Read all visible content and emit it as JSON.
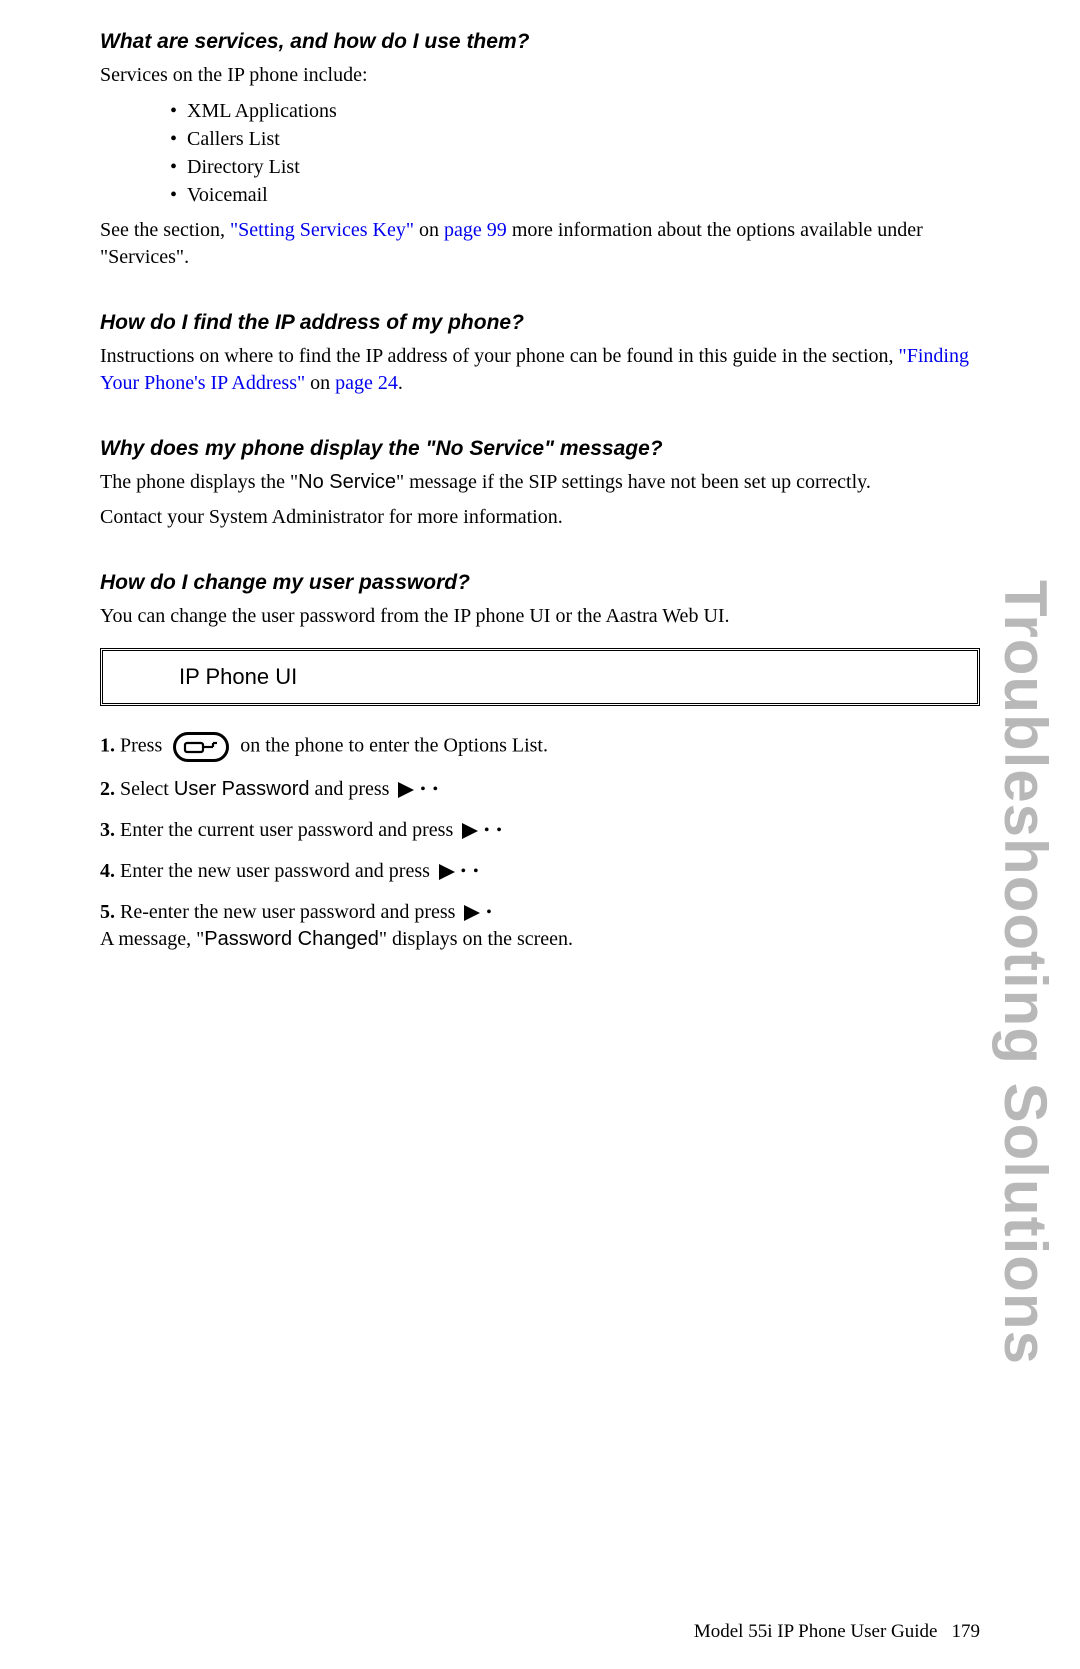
{
  "side_tab": "Troubleshooting Solutions",
  "sections": {
    "services": {
      "heading": "What are services, and how do I use them?",
      "intro": "Services on the IP phone include:",
      "bullets": [
        "XML Applications",
        "Callers List",
        "Directory List",
        "Voicemail"
      ],
      "ref_pre": "See the section, ",
      "ref_link": "\"Setting Services Key\"",
      "ref_on": " on ",
      "ref_page": "page 99",
      "ref_post": " more information about the options available under \"Services\"."
    },
    "ip_address": {
      "heading": "How do I find the IP address of my phone?",
      "text_pre": "Instructions on where to find the IP address of your phone can be found in this guide in the section, ",
      "link": "\"Finding Your Phone's IP Address\"",
      "on": " on ",
      "page": "page 24",
      "post": "."
    },
    "no_service": {
      "heading": "Why does my phone display the \"No Service\" message?",
      "text_pre": "The phone displays the \"",
      "no_service_label": "No Service",
      "text_post": "\" message if the SIP settings have not been set up correctly.",
      "contact": "Contact your System Administrator for more information."
    },
    "password": {
      "heading": "How do I change my user password?",
      "intro": "You can change the user password from the IP phone UI or the Aastra Web UI.",
      "box_label": "IP Phone UI",
      "steps": {
        "s1_num": "1.",
        "s1_a": "Press",
        "s1_b": "on the phone to enter the Options List.",
        "s2_num": "2.",
        "s2_a": "Select ",
        "s2_label": "User Password",
        "s2_b": " and press",
        "s3_num": "3.",
        "s3": "Enter the current user password and press",
        "s4_num": "4.",
        "s4": "Enter the new user password and press",
        "s5_num": "5.",
        "s5": "Re-enter the new user password and press",
        "s5_msg_a": "A message, \"",
        "s5_label": "Password Changed",
        "s5_msg_b": "\" displays on the screen."
      }
    }
  },
  "footer": {
    "title": "Model 55i IP Phone User Guide",
    "page": "179"
  }
}
